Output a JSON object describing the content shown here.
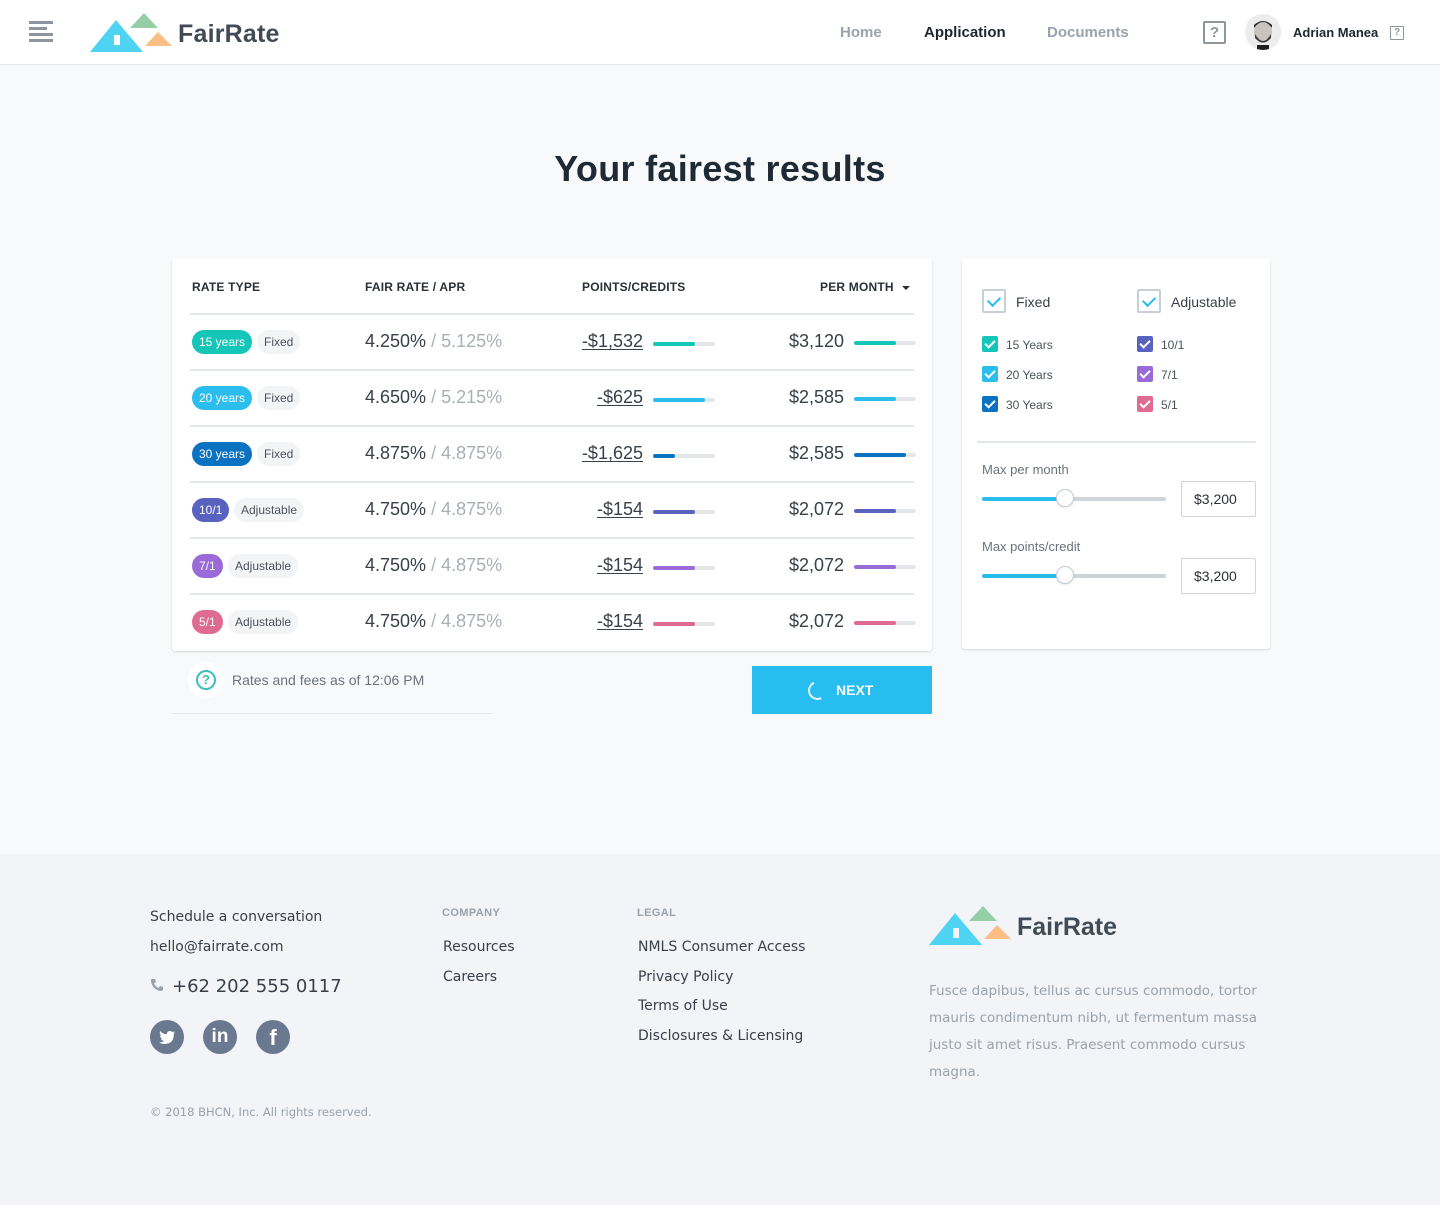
{
  "header": {
    "brand": "FairRate",
    "nav": [
      {
        "label": "Home",
        "active": false
      },
      {
        "label": "Application",
        "active": true
      },
      {
        "label": "Documents",
        "active": false
      }
    ],
    "help_icon": "?",
    "user_name": "Adrian Manea",
    "user_help_icon": "?"
  },
  "page": {
    "title": "Your fairest results"
  },
  "results": {
    "columns": {
      "rate_type": "RATE TYPE",
      "fair_rate": "FAIR RATE / APR",
      "points": "POINTS/CREDITS",
      "per_month": "PER MONTH"
    },
    "rows": [
      {
        "term": "15 years",
        "type": "Fixed",
        "rate": "4.250%",
        "apr": "/ 5.125%",
        "points": "-$1,532",
        "points_fill": 0.68,
        "per_month": "$3,120",
        "per_month_fill": 0.68,
        "color": "#14c6b8"
      },
      {
        "term": "20 years",
        "type": "Fixed",
        "rate": "4.650%",
        "apr": "/ 5.215%",
        "points": "-$625",
        "points_fill": 0.84,
        "per_month": "$2,585",
        "per_month_fill": 0.68,
        "color": "#2bbdee"
      },
      {
        "term": "30 years",
        "type": "Fixed",
        "rate": "4.875%",
        "apr": "/ 4.875%",
        "points": "-$1,625",
        "points_fill": 0.35,
        "per_month": "$2,585",
        "per_month_fill": 0.84,
        "color": "#0b72c2"
      },
      {
        "term": "10/1",
        "type": "Adjustable",
        "rate": "4.750%",
        "apr": "/ 4.875%",
        "points": "-$154",
        "points_fill": 0.68,
        "per_month": "$2,072",
        "per_month_fill": 0.68,
        "color": "#5a62c0"
      },
      {
        "term": "7/1",
        "type": "Adjustable",
        "rate": "4.750%",
        "apr": "/ 4.875%",
        "points": "-$154",
        "points_fill": 0.68,
        "per_month": "$2,072",
        "per_month_fill": 0.68,
        "color": "#9a6ad9"
      },
      {
        "term": "5/1",
        "type": "Adjustable",
        "rate": "4.750%",
        "apr": "/ 4.875%",
        "points": "-$154",
        "points_fill": 0.68,
        "per_month": "$2,072",
        "per_month_fill": 0.68,
        "color": "#e06b90"
      }
    ],
    "info_text": "Rates and fees as of 12:06 PM",
    "next_label": "NEXT"
  },
  "filters": {
    "fixed": {
      "label": "Fixed",
      "checked": true,
      "options": [
        {
          "label": "15 Years",
          "checked": true,
          "color": "#14c6b8"
        },
        {
          "label": "20 Years",
          "checked": true,
          "color": "#2bbdee"
        },
        {
          "label": "30 Years",
          "checked": true,
          "color": "#0b72c2"
        }
      ]
    },
    "adjustable": {
      "label": "Adjustable",
      "checked": true,
      "options": [
        {
          "label": "10/1",
          "checked": true,
          "color": "#5a62c0"
        },
        {
          "label": "7/1",
          "checked": true,
          "color": "#9a6ad9"
        },
        {
          "label": "5/1",
          "checked": true,
          "color": "#e06b90"
        }
      ]
    },
    "max_per_month": {
      "label": "Max per month",
      "value": "$3,200",
      "slider_fraction": 0.45
    },
    "max_points": {
      "label": "Max points/credit",
      "value": "$3,200",
      "slider_fraction": 0.45
    }
  },
  "footer": {
    "contact": {
      "schedule": "Schedule a conversation",
      "email": "hello@fairrate.com",
      "phone": "+62 202 555 0117"
    },
    "social": [
      "twitter",
      "linkedin",
      "facebook"
    ],
    "company": {
      "heading": "COMPANY",
      "links": [
        "Resources",
        "Careers"
      ]
    },
    "legal": {
      "heading": "LEGAL",
      "links": [
        "NMLS Consumer Access",
        "Privacy Policy",
        "Terms of Use",
        "Disclosures & Licensing"
      ]
    },
    "brand": "FairRate",
    "description": "Fusce dapibus, tellus ac cursus commodo, tortor mauris condimentum nibh, ut fermentum massa justo sit amet risus. Praesent commodo cursus magna.",
    "copyright": "© 2018 BHCN, Inc. All rights reserved."
  }
}
